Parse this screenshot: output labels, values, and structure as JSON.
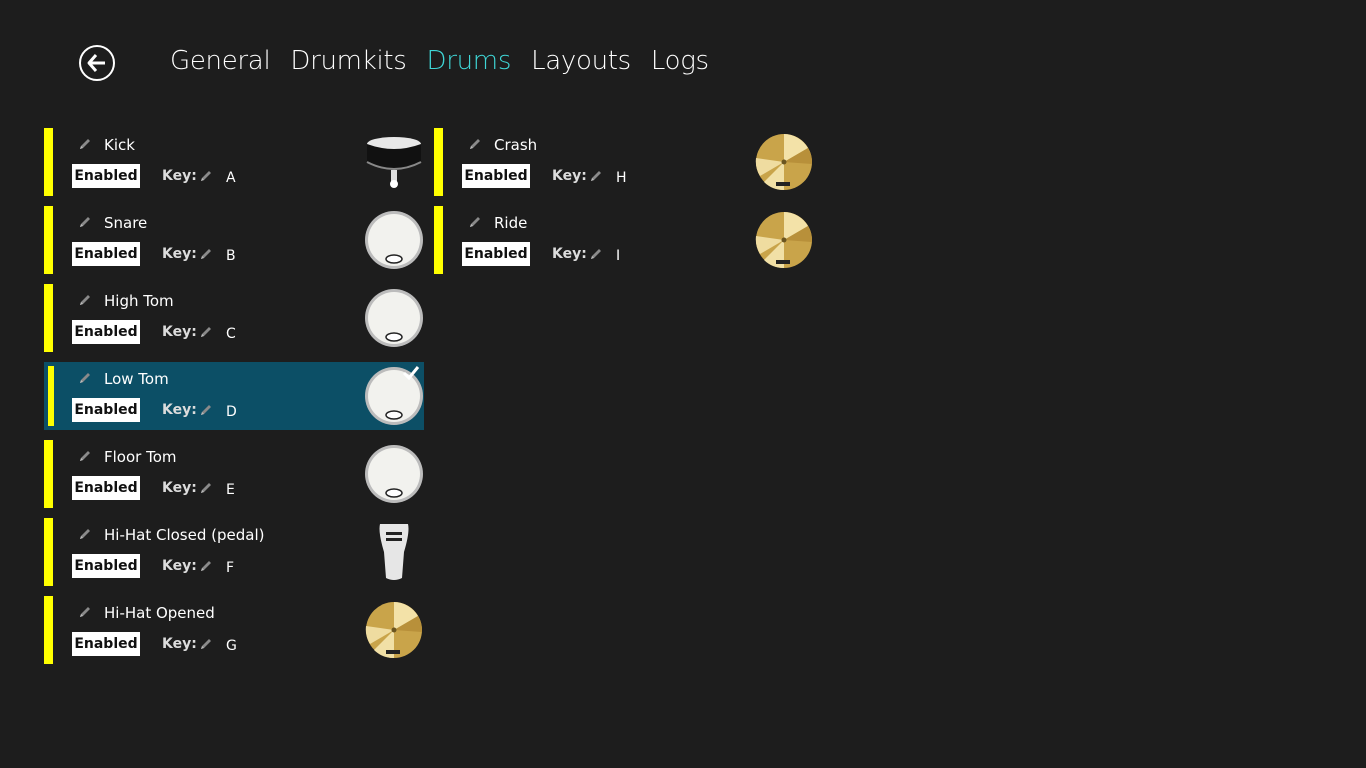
{
  "nav": {
    "tabs": [
      "General",
      "Drumkits",
      "Drums",
      "Layouts",
      "Logs"
    ],
    "active": "Drums"
  },
  "colors": {
    "accent": "#3fd6d6",
    "indicator": "#ffff00",
    "selected_bg": "#0c4f66",
    "background": "#1d1d1d"
  },
  "key_label": "Key:",
  "drums_left": [
    {
      "name": "Kick",
      "status": "Enabled",
      "key": "A",
      "icon": "kick-drum-icon"
    },
    {
      "name": "Snare",
      "status": "Enabled",
      "key": "B",
      "icon": "snare-drum-icon"
    },
    {
      "name": "High Tom",
      "status": "Enabled",
      "key": "C",
      "icon": "tom-drum-icon"
    },
    {
      "name": "Low Tom",
      "status": "Enabled",
      "key": "D",
      "icon": "tom-drum-icon",
      "selected": true
    },
    {
      "name": "Floor Tom",
      "status": "Enabled",
      "key": "E",
      "icon": "tom-drum-icon"
    },
    {
      "name": "Hi-Hat Closed (pedal)",
      "status": "Enabled",
      "key": "F",
      "icon": "pedal-icon"
    },
    {
      "name": "Hi-Hat Opened",
      "status": "Enabled",
      "key": "G",
      "icon": "cymbal-icon"
    }
  ],
  "drums_right": [
    {
      "name": "Crash",
      "status": "Enabled",
      "key": "H",
      "icon": "cymbal-icon"
    },
    {
      "name": "Ride",
      "status": "Enabled",
      "key": "I",
      "icon": "cymbal-icon"
    }
  ]
}
